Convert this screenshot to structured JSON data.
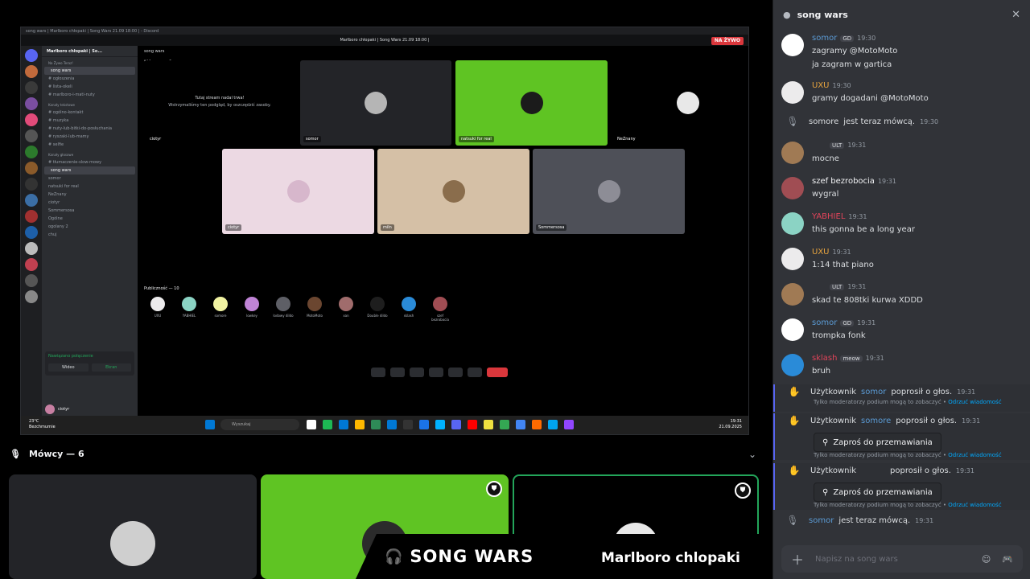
{
  "inner_window": {
    "title": "song wars | Marlboro chłopaki | Song Wars 21.09 18:00 | - Discord",
    "stream_title": "Marlboro chłopaki | Song Wars 21.09 18:00 |",
    "live_badge": "NA ŻYWO",
    "server_name": "Marlboro chłopaki | So...",
    "channel_lines": [
      {
        "text": "Na Żywo Teraz!",
        "kind": "cat"
      },
      {
        "text": "song wars",
        "kind": "sel"
      },
      {
        "text": "# ogłoszenia",
        "kind": ""
      },
      {
        "text": "# lista-okeli",
        "kind": ""
      },
      {
        "text": "# marlboro-i-mati-nuty",
        "kind": ""
      },
      {
        "text": "Kanały tekstowe",
        "kind": "cat"
      },
      {
        "text": "# ogólno-kontakt",
        "kind": ""
      },
      {
        "text": "# muzyka",
        "kind": ""
      },
      {
        "text": "# nuty-lub-bitki-do-posłuchania",
        "kind": ""
      },
      {
        "text": "# ryszaki-lub-mamy",
        "kind": ""
      },
      {
        "text": "# selfie",
        "kind": ""
      },
      {
        "text": "Kanały głosowe",
        "kind": "cat"
      },
      {
        "text": "# tłumaczenie-slow-mowy",
        "kind": ""
      },
      {
        "text": "song wars",
        "kind": "sel"
      },
      {
        "text": "somor",
        "kind": ""
      },
      {
        "text": "natsuki for real",
        "kind": ""
      },
      {
        "text": "NeZnany",
        "kind": ""
      },
      {
        "text": "ciotyr",
        "kind": ""
      },
      {
        "text": "Sommersosa",
        "kind": ""
      },
      {
        "text": "Ogólne",
        "kind": ""
      },
      {
        "text": "ogolany 2",
        "kind": ""
      },
      {
        "text": "chuj",
        "kind": ""
      }
    ],
    "voice_header": "song wars",
    "speakers_label": "Mówcy — 6",
    "stream_hint_title": "Tutaj stream nadal trwa!",
    "stream_hint_sub": "Wstrzymaliśmy ten podgląd, by oszczędzić zasoby.",
    "stream_tiles": [
      {
        "label": "ciotyr",
        "color": "#000000",
        "avatar": "#000000"
      },
      {
        "label": "somor",
        "color": "#232428",
        "avatar": "#b5b5b5"
      },
      {
        "label": "natsuki for real",
        "color": "#5fc423",
        "avatar": "#1b1b1b"
      },
      {
        "label": "NeZnany",
        "color": "#000000",
        "avatar": "#e8e8e8"
      },
      {
        "label": "ciotyr",
        "color": "#ecd9e3",
        "avatar": "#d7b7cc"
      },
      {
        "label": "miln",
        "color": "#d5c0a6",
        "avatar": "#8a6d4c"
      },
      {
        "label": "Sommersosa",
        "color": "#4e5058",
        "avatar": "#8d8d96"
      }
    ],
    "audience_label": "Publiczność — 10",
    "audience": [
      {
        "name": "UXU",
        "color": "#ecebec"
      },
      {
        "name": "YABHIEL",
        "color": "#8bd3c4"
      },
      {
        "name": "somore",
        "color": "#f1f3a2"
      },
      {
        "name": "lowkey",
        "color": "#c084d6"
      },
      {
        "name": "lodowy dildo",
        "color": "#5e5f66"
      },
      {
        "name": "MotoMoto",
        "color": "#6b4630"
      },
      {
        "name": "xan",
        "color": "#a06c6c"
      },
      {
        "name": "Double dildo",
        "color": "#1e1e1e"
      },
      {
        "name": "sklash",
        "color": "#2a8bd8"
      },
      {
        "name": "szef bezrobocia",
        "color": "#a04d53"
      }
    ],
    "user_name": "ciotyr",
    "voice_connected": "Nawiązano połączenie",
    "video_btn": "Wideo",
    "screen_btn": "Ekran",
    "taskbar": {
      "weather_temp": "23°C",
      "weather_desc": "Bezchmurnie",
      "search": "Wyszukaj",
      "time": "19:31",
      "date": "21.09.2025"
    },
    "taskbar_icon_colors": [
      "#ffffff",
      "#1db954",
      "#0078d4",
      "#ffb900",
      "#2e8b57",
      "#0078d4",
      "#333333",
      "#1a73e8",
      "#00b2ff",
      "#5865f2",
      "#ff0000",
      "#f0e040",
      "#34a853",
      "#4285f4",
      "#ff6a00",
      "#00a4ef",
      "#9146ff"
    ]
  },
  "speakers": {
    "label": "Mówcy — 6",
    "tiles": [
      {
        "color": "#232428",
        "avatar": "#cfcfcf"
      },
      {
        "color": "#5fc423",
        "avatar": "#2b2b2b"
      },
      {
        "color": "#000000",
        "avatar": "#e8e8e8"
      }
    ]
  },
  "banner": {
    "left": "SONG WARS",
    "right": "Marlboro chlopaki"
  },
  "chat": {
    "title": "song wars",
    "input_placeholder": "Napisz na song wars",
    "messages": [
      {
        "name": "somor",
        "name_color": "#5b9bd5",
        "badge": "GD",
        "time": "19:30",
        "lines": [
          "zagramy @MotoMoto",
          "ja zagram w gartica"
        ],
        "avatar": "#ffffff"
      },
      {
        "name": "UXU",
        "name_color": "#e6a33e",
        "badge": "",
        "time": "19:30",
        "lines": [
          "gramy dogadani @MotoMoto"
        ],
        "avatar": "#ecebec"
      },
      {
        "name": "",
        "name_color": "#c586c0",
        "badge": "ULT",
        "time": "19:31",
        "lines": [
          "mocne"
        ],
        "avatar": "#a07a54"
      },
      {
        "name": "szef bezrobocia",
        "name_color": "#f2f3f5",
        "badge": "",
        "time": "19:31",
        "lines": [
          "wygral"
        ],
        "avatar": "#a04d53"
      },
      {
        "name": "YABHIEL",
        "name_color": "#e0445a",
        "badge": "",
        "time": "19:31",
        "lines": [
          "this gonna be a long year"
        ],
        "avatar": "#8bd3c4"
      },
      {
        "name": "UXU",
        "name_color": "#e6a33e",
        "badge": "",
        "time": "19:31",
        "lines": [
          "1:14 that piano"
        ],
        "avatar": "#ecebec"
      },
      {
        "name": "",
        "name_color": "#c586c0",
        "badge": "ULT",
        "time": "19:31",
        "lines": [
          "skad te 808tki kurwa XDDD"
        ],
        "avatar": "#a07a54"
      },
      {
        "name": "somor",
        "name_color": "#5b9bd5",
        "badge": "GD",
        "time": "19:31",
        "lines": [
          "trompka fonk"
        ],
        "avatar": "#ffffff"
      },
      {
        "name": "sklash",
        "name_color": "#e0445a",
        "badge": "meow",
        "time": "19:31",
        "lines": [
          "bruh"
        ],
        "avatar": "#2a8bd8"
      }
    ],
    "sys_speaker": {
      "text_a": "somore",
      "text_b": "jest teraz mówcą.",
      "time": "19:30"
    },
    "requests": [
      {
        "prefix": "Użytkownik",
        "user": "somor",
        "suffix": "poprosił o głos.",
        "time": "19:31",
        "button": ""
      },
      {
        "prefix": "Użytkownik",
        "user": "somore",
        "suffix": "poprosił o głos.",
        "time": "19:31",
        "button": "Zaproś do przemawiania"
      },
      {
        "prefix": "Użytkownik",
        "user": "",
        "suffix": "poprosił o głos.",
        "time": "19:31",
        "button": "Zaproś do przemawiania"
      }
    ],
    "mod_note": "Tylko moderatorzy podium mogą to zobaczyć",
    "mod_note_link": "Odrzuć wiadomość",
    "final": {
      "user": "somor",
      "text": "jest teraz mówcą.",
      "time": "19:31"
    }
  }
}
